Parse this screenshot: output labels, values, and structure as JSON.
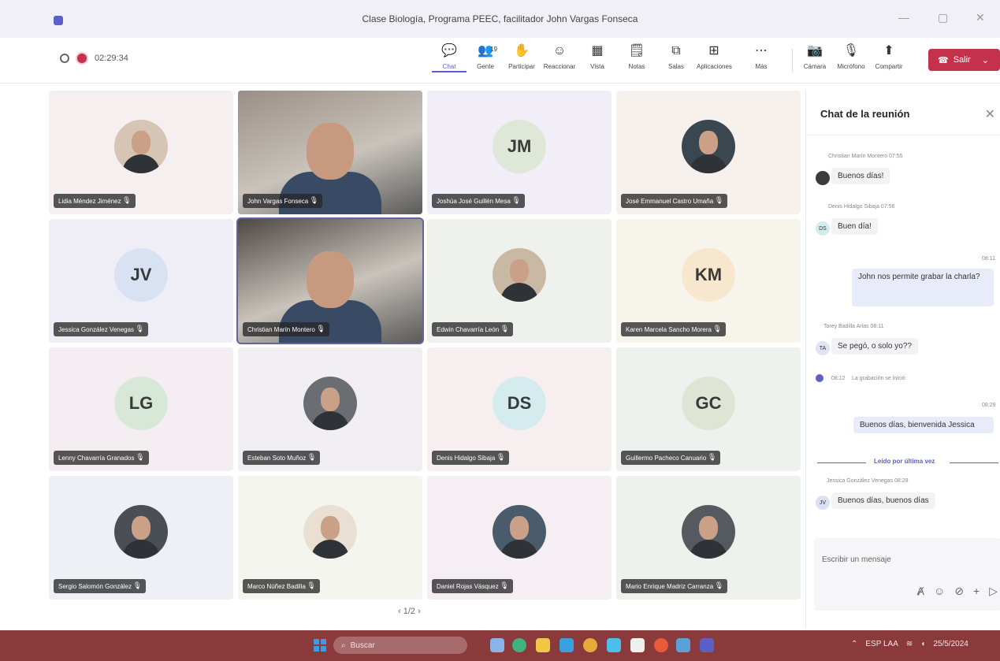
{
  "window": {
    "title": "Clase Biología, Programa PEEC, facilitador John Vargas Fonseca",
    "controls": [
      "—",
      "▢",
      "✕"
    ]
  },
  "toolbar": {
    "timer": "02:29:34",
    "buttons": [
      {
        "label": "Chat",
        "icon": "chat-icon",
        "glyph": "💬",
        "active": true
      },
      {
        "label": "Gente",
        "icon": "people-icon",
        "glyph": "👥",
        "count": "19"
      },
      {
        "label": "Participar",
        "icon": "raise-hand-icon",
        "glyph": "✋"
      },
      {
        "label": "Reaccionar",
        "icon": "reaction-icon",
        "glyph": "☺"
      },
      {
        "label": "Vista",
        "icon": "view-grid-icon",
        "glyph": "▦"
      },
      {
        "label": "Notas",
        "icon": "notes-icon",
        "glyph": "🗒"
      },
      {
        "label": "Salas",
        "icon": "rooms-icon",
        "glyph": "⧉"
      },
      {
        "label": "Aplicaciones",
        "icon": "apps-icon",
        "glyph": "⊞"
      },
      {
        "label": "Más",
        "icon": "more-icon",
        "glyph": "⋯"
      },
      {
        "label": "Cámara",
        "icon": "camera-icon",
        "glyph": "📷"
      },
      {
        "label": "Micrófono",
        "icon": "microphone-icon",
        "glyph": "🎙"
      },
      {
        "label": "Compartir",
        "icon": "share-icon",
        "glyph": "⬆"
      }
    ],
    "leave_label": "Salir"
  },
  "participants": [
    {
      "name": "Lidia Méndez Jiménez",
      "type": "photo",
      "bg": "#f6efef",
      "avatar_color": "#d6c4b5"
    },
    {
      "name": "John Vargas Fonseca",
      "type": "video",
      "bg": "#9a8f86"
    },
    {
      "name": "Joshúa José Guillén Mesa",
      "initials": "JM",
      "type": "initials",
      "bg": "#f1eef7",
      "avatar_color": "#dfe8d8"
    },
    {
      "name": "José Emmanuel Castro Umaña",
      "type": "photo",
      "bg": "#f7f1ed",
      "avatar_color": "#3b4750"
    },
    {
      "name": "Jessica González Venegas",
      "initials": "JV",
      "type": "initials",
      "bg": "#efeef7",
      "avatar_color": "#d8e2f3"
    },
    {
      "name": "Christian Marín Montero",
      "type": "video",
      "bg": "#4d4944",
      "selected": true
    },
    {
      "name": "Edwin Chavarría León",
      "type": "photo",
      "bg": "#eef1ec",
      "avatar_color": "#c9b8a4"
    },
    {
      "name": "Karen Marcela Sancho Morera",
      "initials": "KM",
      "type": "initials",
      "bg": "#f7f4ec",
      "avatar_color": "#f7e7cf"
    },
    {
      "name": "Lenny Chavarría Granados",
      "initials": "LG",
      "type": "initials",
      "bg": "#f4eef2",
      "avatar_color": "#d8e8d8"
    },
    {
      "name": "Esteban Soto Muñoz",
      "type": "photo",
      "bg": "#f1eef4",
      "avatar_color": "#6a6e73"
    },
    {
      "name": "Denis Hidalgo Sibaja",
      "initials": "DS",
      "type": "initials",
      "bg": "#f7efef",
      "avatar_color": "#d5ecef"
    },
    {
      "name": "Guillermo Pacheco Canuario",
      "initials": "GC",
      "type": "initials",
      "bg": "#eef2ee",
      "avatar_color": "#dfe5d5"
    },
    {
      "name": "Sergio Salomón González",
      "type": "photo",
      "bg": "#eef0f5",
      "avatar_color": "#4a4f55"
    },
    {
      "name": "Marco Núñez Badilla",
      "type": "photo",
      "bg": "#f3f5ee",
      "avatar_color": "#e9dfd3"
    },
    {
      "name": "Daniel Rojas Vásquez",
      "type": "photo",
      "bg": "#f5eef3",
      "avatar_color": "#4a5c6b"
    },
    {
      "name": "Mario Enrique Madriz Carranza",
      "type": "photo",
      "bg": "#eef1ec",
      "avatar_color": "#555a60"
    }
  ],
  "pager": "1/2",
  "chat": {
    "title": "Chat de la reunión",
    "messages": [
      {
        "meta": "Christian Marín Montero 07:55",
        "text": "Buenos días!"
      },
      {
        "meta": "Denis Hidalgo Sibaja 07:56",
        "text": "Buen día!",
        "initials": "DS"
      },
      {
        "meta": "08:11",
        "text": "John nos permite grabar la charla?",
        "mine": true
      },
      {
        "meta": "Torey Badilla Arias 08:11",
        "text": "Se pegó, o solo yo??",
        "initials": "TA"
      },
      {
        "meta": "08:12",
        "text": "La grabación se inició"
      },
      {
        "meta": "08:29",
        "text": "Buenos días, bienvenida Jessica",
        "mine": true
      },
      {
        "meta": "Jessica González Venegas 08:29",
        "text": "Buenos días, buenos días",
        "initials": "JV"
      }
    ],
    "read_label": "Leído por última vez",
    "compose_placeholder": "Escribir un mensaje"
  },
  "taskbar": {
    "search_placeholder": "Buscar",
    "tray_text": "ESP LAA",
    "date": "25/5/2024"
  },
  "colors": {
    "accent": "#5b5fc7",
    "leave": "#c4314b",
    "taskbar": "#8a3a3a"
  }
}
